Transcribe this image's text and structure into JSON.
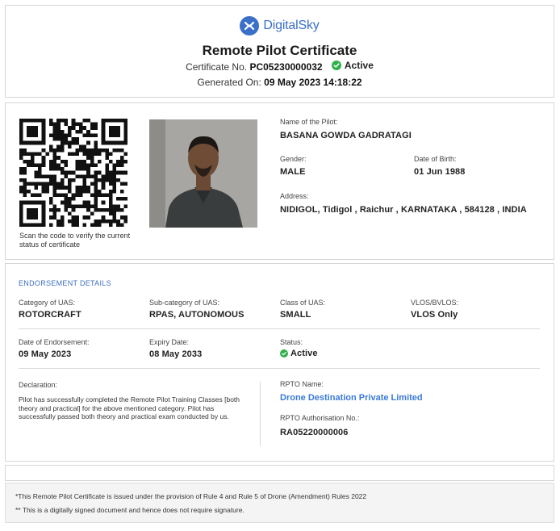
{
  "header": {
    "brand": "DigitalSky",
    "title": "Remote Pilot Certificate",
    "cert_no_label": "Certificate No.",
    "cert_no": "PC05230000032",
    "status": "Active",
    "generated_label": "Generated On:",
    "generated_value": "09 May 2023 14:18:22"
  },
  "pilot": {
    "qr_caption": "Scan the code to verify the current status of certificate",
    "name_label": "Name of the Pilot:",
    "name": "BASANA GOWDA GADRATAGI",
    "gender_label": "Gender:",
    "gender": "MALE",
    "dob_label": "Date of Birth:",
    "dob": "01 Jun 1988",
    "address_label": "Address:",
    "address": "NIDIGOL, Tidigol , Raichur , KARNATAKA , 584128 , INDIA"
  },
  "endorsement": {
    "section_title": "ENDORSEMENT DETAILS",
    "category_label": "Category of UAS:",
    "category": "ROTORCRAFT",
    "subcategory_label": "Sub-category of UAS:",
    "subcategory": "RPAS, AUTONOMOUS",
    "class_label": "Class of UAS:",
    "class": "SMALL",
    "vlos_label": "VLOS/BVLOS:",
    "vlos": "VLOS Only",
    "date_label": "Date of Endorsement:",
    "date": "09 May 2023",
    "expiry_label": "Expiry Date:",
    "expiry": "08 May 2033",
    "status_label": "Status:",
    "status": "Active",
    "declaration_label": "Declaration:",
    "declaration": "Pilot has successfully completed the Remote Pilot Training Classes [both theory and practical] for the above mentioned category. Pilot has successfully passed both theory and practical exam conducted by us.",
    "rpto_name_label": "RPTO Name:",
    "rpto_name": "Drone Destination Private Limited",
    "rpto_auth_label": "RPTO Authorisation No.:",
    "rpto_auth": "RA05220000006"
  },
  "footer": {
    "note1": "*This Remote Pilot Certificate is issued under the provision of Rule 4 and Rule 5 of Drone (Amendment) Rules 2022",
    "note2": "** This is a digitally signed document and hence does not require signature."
  },
  "colors": {
    "brand_blue": "#3a70c8",
    "link_blue": "#3a7ad8",
    "active_green": "#2eb04a"
  },
  "icons": [
    "digitalsky-logo-icon",
    "check-circle-icon",
    "qr-code"
  ]
}
